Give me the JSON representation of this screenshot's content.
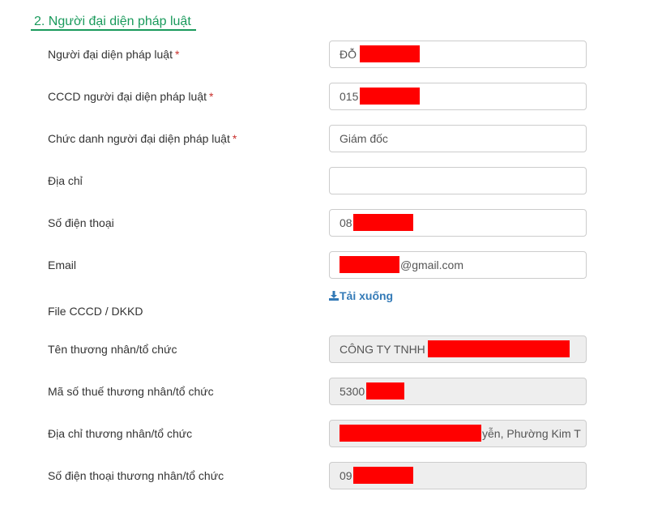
{
  "section": {
    "title": "2. Người đại diện pháp luật"
  },
  "required_mark": "*",
  "fields": [
    {
      "label": "Người đại diện pháp luật",
      "required": true,
      "value": "ĐỖ"
    },
    {
      "label": "CCCD người đại diện pháp luật",
      "required": true,
      "value": "015"
    },
    {
      "label": "Chức danh người đại diện pháp luật",
      "required": true,
      "value": "Giám đốc"
    },
    {
      "label": "Địa chỉ",
      "required": false,
      "value": ""
    },
    {
      "label": "Số điện thoại",
      "required": false,
      "value": "08"
    },
    {
      "label": "Email",
      "required": false,
      "value": "@gmail.com"
    },
    {
      "label": "File CCCD / DKKD",
      "required": false,
      "link": "Tải xuống"
    },
    {
      "label": "Tên thương nhân/tổ chức",
      "required": false,
      "value": "CÔNG TY TNHH"
    },
    {
      "label": "Mã số thuế thương nhân/tổ chức",
      "required": false,
      "value": "5300"
    },
    {
      "label": "Địa chỉ thương nhân/tổ chức",
      "required": false,
      "value": "yễn, Phường Kim T"
    },
    {
      "label": "Số điện thoại thương nhân/tổ chức",
      "required": false,
      "value": "09"
    }
  ],
  "colors": {
    "accent": "#1a9a5c",
    "required": "#c9302c",
    "link": "#337ab7",
    "readonly_bg": "#eeeeee",
    "redaction": "#ff0000"
  },
  "icons": {
    "download": "download-icon"
  }
}
